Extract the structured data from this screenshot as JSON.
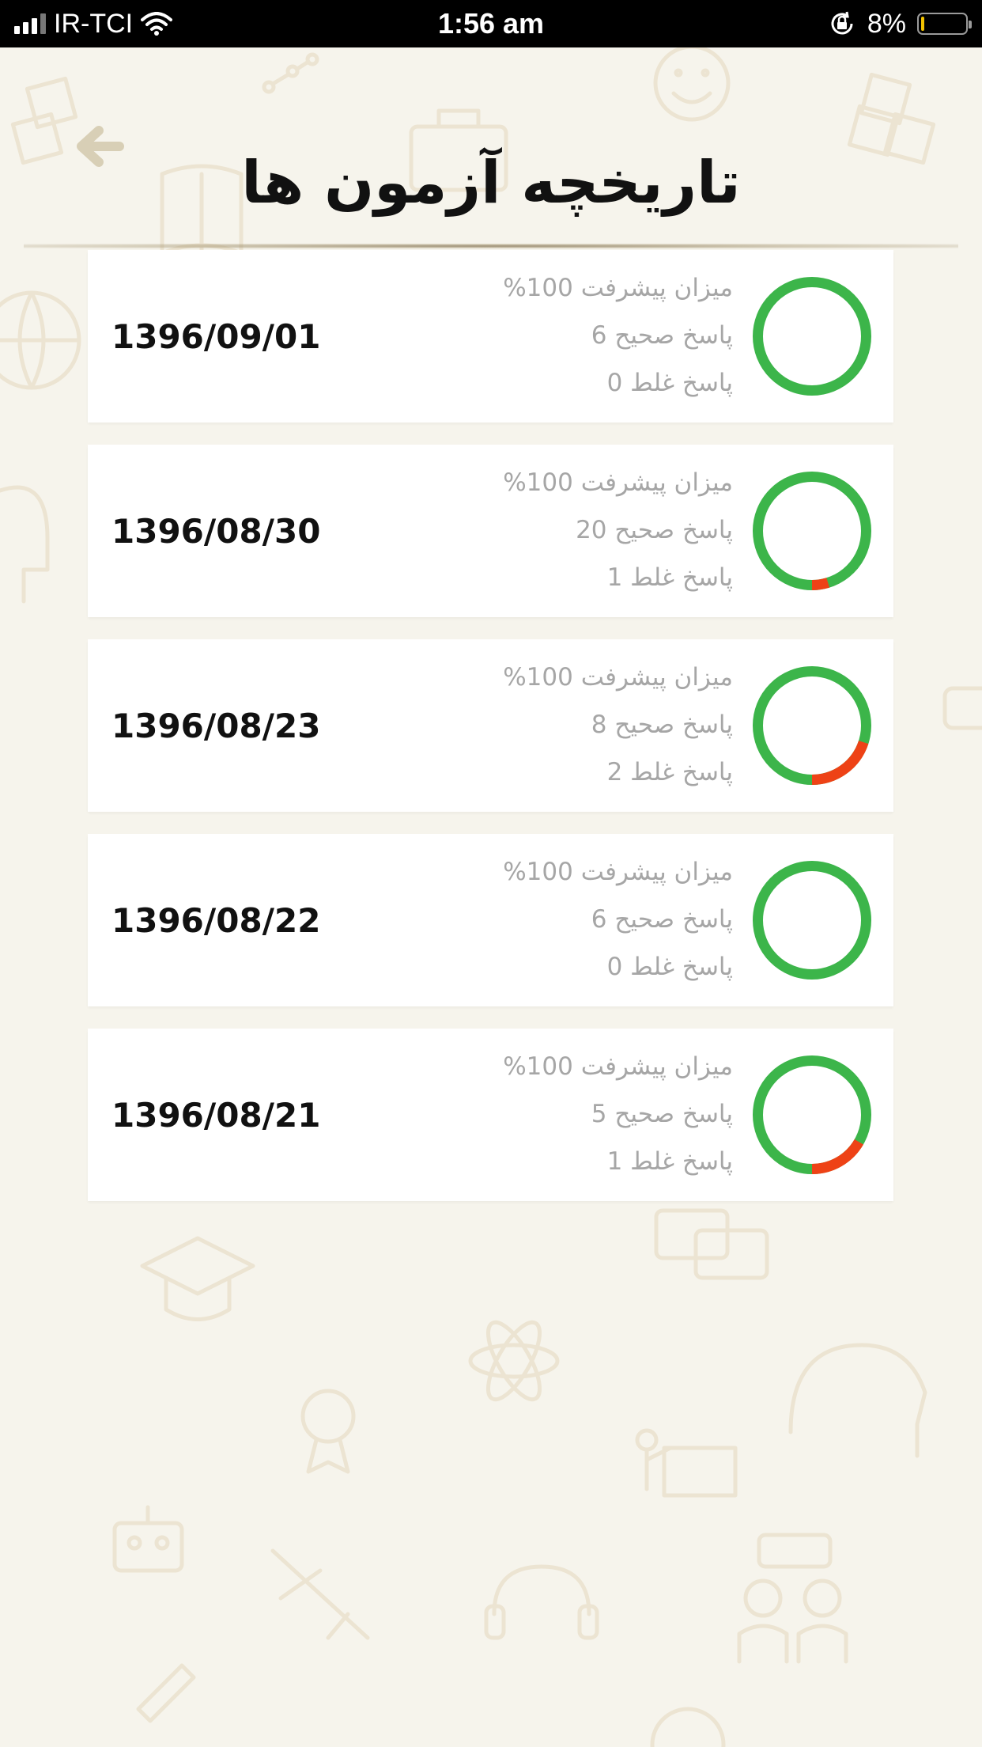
{
  "status_bar": {
    "carrier": "IR-TCI",
    "time": "1:56 am",
    "battery_percent": "8%",
    "battery_level": 0.08,
    "icons": [
      "signal-icon",
      "wifi-icon",
      "orientation-lock-icon",
      "battery-icon"
    ]
  },
  "header": {
    "title": "تاریخچه آزمون ها",
    "back_icon": "arrow-left-icon"
  },
  "colors": {
    "correct": "#3cb54a",
    "wrong": "#ee4216",
    "background": "#f6f4ec",
    "card": "#ffffff",
    "date_text": "#111111",
    "info_text": "#a6a6a6"
  },
  "exams": [
    {
      "date": "1396/09/01",
      "progress": "میزان پیشرفت 100%",
      "correct": "پاسخ صحیح 6",
      "wrong": "پاسخ غلط 0",
      "correct_count": 6,
      "wrong_count": 0
    },
    {
      "date": "1396/08/30",
      "progress": "میزان پیشرفت 100%",
      "correct": "پاسخ صحیح 20",
      "wrong": "پاسخ غلط 1",
      "correct_count": 20,
      "wrong_count": 1
    },
    {
      "date": "1396/08/23",
      "progress": "میزان پیشرفت 100%",
      "correct": "پاسخ صحیح 8",
      "wrong": "پاسخ غلط 2",
      "correct_count": 8,
      "wrong_count": 2
    },
    {
      "date": "1396/08/22",
      "progress": "میزان پیشرفت 100%",
      "correct": "پاسخ صحیح 6",
      "wrong": "پاسخ غلط 0",
      "correct_count": 6,
      "wrong_count": 0
    },
    {
      "date": "1396/08/21",
      "progress": "میزان پیشرفت 100%",
      "correct": "پاسخ صحیح 5",
      "wrong": "پاسخ غلط 1",
      "correct_count": 5,
      "wrong_count": 1
    }
  ]
}
